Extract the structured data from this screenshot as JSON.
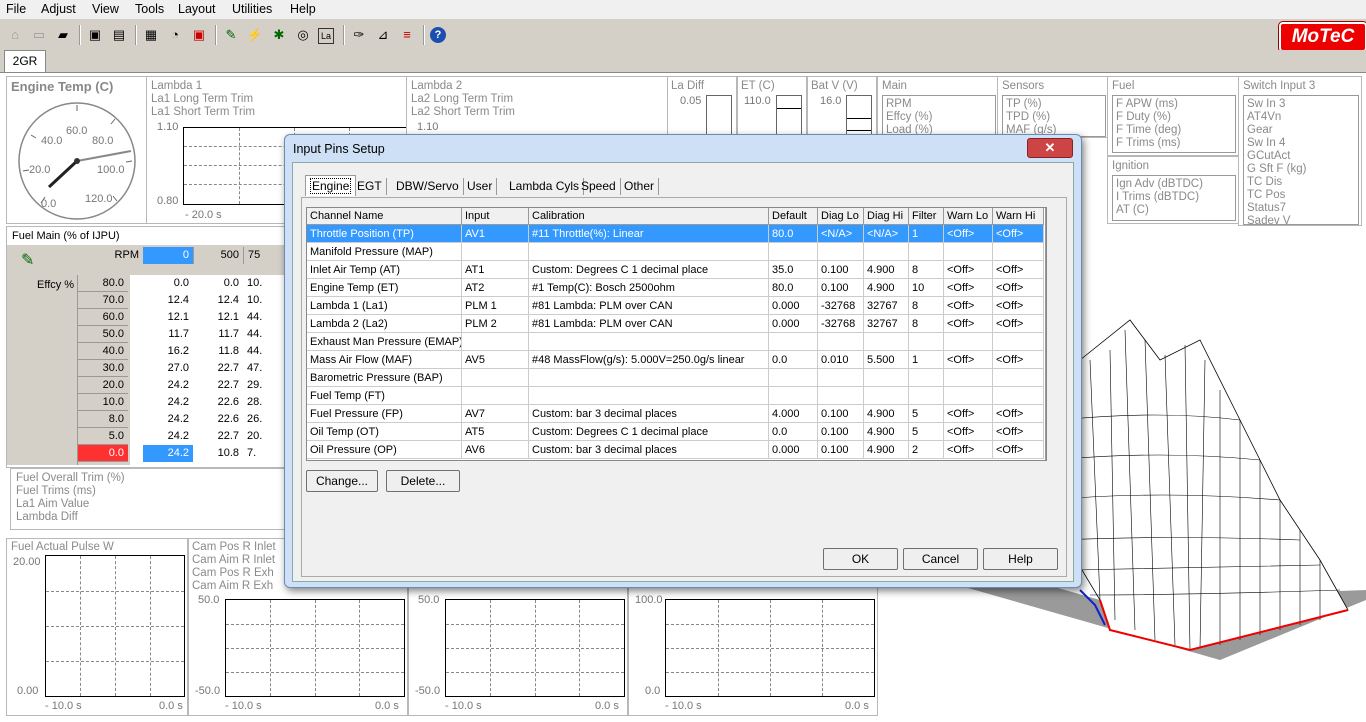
{
  "menu": [
    "File",
    "Adjust",
    "View",
    "Tools",
    "Layout",
    "Utilities",
    "Help"
  ],
  "logo": "MoTeC",
  "tab": "2GR",
  "engine_temp": {
    "title": "Engine Temp (C)",
    "ticks": [
      "0.0",
      "20.0",
      "40.0",
      "60.0",
      "80.0",
      "100.0",
      "120.0"
    ]
  },
  "lambda1": {
    "labels": [
      "Lambda 1",
      "La1 Long Term Trim",
      "La1 Short Term Trim"
    ],
    "ymax": "1.10",
    "ymin": "0.80",
    "xlabel": "- 20.0 s"
  },
  "lambda2": {
    "labels": [
      "Lambda 2",
      "La2 Long Term Trim",
      "La2 Short Term Trim"
    ],
    "ymax": "1.10"
  },
  "ladiff": {
    "label": "La Diff",
    "value": "0.05"
  },
  "et": {
    "label": "ET (C)",
    "value": "110.0"
  },
  "batv": {
    "label": "Bat V (V)",
    "value": "16.0"
  },
  "main": {
    "label": "Main",
    "items": [
      "RPM",
      "Effcy (%)",
      "Load (%)"
    ]
  },
  "sensors": {
    "label": "Sensors",
    "items": [
      "TP (%)",
      "TPD (%)",
      "MAF (g/s)"
    ]
  },
  "fuel": {
    "label": "Fuel",
    "items": [
      "F APW (ms)",
      "F Duty (%)",
      "F Time (deg)",
      "F Trims (ms)"
    ]
  },
  "ignition": {
    "label": "Ignition",
    "items": [
      "Ign Adv (dBTDC)",
      "I Trims (dBTDC)",
      "AT (C)"
    ]
  },
  "switch_input": {
    "label": "Switch Input 3",
    "items": [
      "Sw In 3",
      "AT4Vn",
      "Gear",
      "Sw In 4",
      "GCutAct",
      "G Sft F (kg)",
      "TC Dis",
      "TC Pos",
      "Status7",
      "Sadev V"
    ]
  },
  "fuel_main": {
    "title": "Fuel Main (% of IJPU)",
    "rpm_label": "RPM",
    "rpm_values": [
      "0",
      "500",
      "75"
    ],
    "effcy_label": "Effcy %",
    "rows": [
      {
        "load": "80.0",
        "v": [
          "0.0",
          "0.0",
          "10."
        ]
      },
      {
        "load": "70.0",
        "v": [
          "12.4",
          "12.4",
          "10."
        ]
      },
      {
        "load": "60.0",
        "v": [
          "12.1",
          "12.1",
          "44."
        ]
      },
      {
        "load": "50.0",
        "v": [
          "11.7",
          "11.7",
          "44."
        ]
      },
      {
        "load": "40.0",
        "v": [
          "16.2",
          "11.8",
          "44."
        ]
      },
      {
        "load": "30.0",
        "v": [
          "27.0",
          "22.7",
          "47."
        ]
      },
      {
        "load": "20.0",
        "v": [
          "24.2",
          "22.7",
          "29."
        ]
      },
      {
        "load": "10.0",
        "v": [
          "24.2",
          "22.6",
          "28."
        ]
      },
      {
        "load": "8.0",
        "v": [
          "24.2",
          "22.6",
          "26."
        ]
      },
      {
        "load": "5.0",
        "v": [
          "24.2",
          "22.7",
          "20."
        ]
      },
      {
        "load": "0.0",
        "v": [
          "24.2",
          "10.8",
          "7."
        ]
      }
    ]
  },
  "trim_list": [
    "Fuel Overall Trim (%)",
    "Fuel Trims (ms)",
    "La1 Aim Value",
    "Lambda Diff"
  ],
  "fuel_pulse": {
    "label": "Fuel Actual Pulse W",
    "ymax": "20.00",
    "ymin": "0.00",
    "xl": "- 10.0 s",
    "xr": "0.0 s"
  },
  "cam": {
    "labels": [
      "Cam Pos R Inlet",
      "Cam Aim R Inlet",
      "Cam Pos R Exh",
      "Cam Aim R Exh"
    ],
    "ymax": "50.0",
    "ymin": "-50.0",
    "xl": "- 10.0 s",
    "xr": "0.0 s"
  },
  "graph3": {
    "ymax": "50.0",
    "ymin": "-50.0",
    "xl": "- 10.0 s",
    "xr": "0.0 s"
  },
  "graph4": {
    "ymax": "100.0",
    "ymin": "0.0",
    "xl": "- 10.0 s",
    "xr": "0.0 s"
  },
  "dialog": {
    "title": "Input Pins Setup",
    "close": "✕",
    "tabs": [
      "Engine",
      "EGT",
      "DBW/Servo",
      "User",
      "Lambda Cyls",
      "Speed",
      "Other"
    ],
    "columns": [
      "Channel Name",
      "Input",
      "Calibration",
      "Default",
      "Diag Lo",
      "Diag Hi",
      "Filter",
      "Warn Lo",
      "Warn Hi"
    ],
    "rows": [
      [
        "Throttle Position  (TP)",
        "AV1",
        "#11 Throttle(%): Linear",
        "80.0",
        "<N/A>",
        "<N/A>",
        "1",
        "<Off>",
        "<Off>"
      ],
      [
        "Manifold Pressure  (MAP)",
        "",
        "",
        "",
        "",
        "",
        "",
        "",
        ""
      ],
      [
        "Inlet Air Temp  (AT)",
        "AT1",
        "Custom: Degrees C 1 decimal place",
        "35.0",
        "0.100",
        "4.900",
        "8",
        "<Off>",
        "<Off>"
      ],
      [
        "Engine Temp  (ET)",
        "AT2",
        "#1  Temp(C): Bosch 2500ohm",
        "80.0",
        "0.100",
        "4.900",
        "10",
        "<Off>",
        "<Off>"
      ],
      [
        "Lambda 1  (La1)",
        "PLM 1",
        "#81 Lambda: PLM over CAN",
        "0.000",
        "-32768",
        "32767",
        "8",
        "<Off>",
        "<Off>"
      ],
      [
        "Lambda 2  (La2)",
        "PLM 2",
        "#81 Lambda: PLM over CAN",
        "0.000",
        "-32768",
        "32767",
        "8",
        "<Off>",
        "<Off>"
      ],
      [
        "Exhaust Man Pressure  (EMAP)",
        "",
        "",
        "",
        "",
        "",
        "",
        "",
        ""
      ],
      [
        "Mass Air Flow  (MAF)",
        "AV5",
        "#48 MassFlow(g/s): 5.000V=250.0g/s linear",
        "0.0",
        "0.010",
        "5.500",
        "1",
        "<Off>",
        "<Off>"
      ],
      [
        "Barometric Pressure  (BAP)",
        "",
        "",
        "",
        "",
        "",
        "",
        "",
        ""
      ],
      [
        "Fuel Temp  (FT)",
        "",
        "",
        "",
        "",
        "",
        "",
        "",
        ""
      ],
      [
        "Fuel Pressure  (FP)",
        "AV7",
        "Custom: bar 3 decimal places",
        "4.000",
        "0.100",
        "4.900",
        "5",
        "<Off>",
        "<Off>"
      ],
      [
        "Oil Temp  (OT)",
        "AT5",
        "Custom: Degrees C 1 decimal place",
        "0.0",
        "0.100",
        "4.900",
        "5",
        "<Off>",
        "<Off>"
      ],
      [
        "Oil Pressure  (OP)",
        "AV6",
        "Custom: bar 3 decimal places",
        "0.000",
        "0.100",
        "4.900",
        "2",
        "<Off>",
        "<Off>"
      ]
    ],
    "buttons": {
      "change": "Change...",
      "delete": "Delete...",
      "ok": "OK",
      "cancel": "Cancel",
      "help": "Help"
    }
  },
  "colors": {
    "selection": "#3399ff",
    "highlight_red": "#ff3030",
    "dialog_frame": "#cde0f5"
  }
}
